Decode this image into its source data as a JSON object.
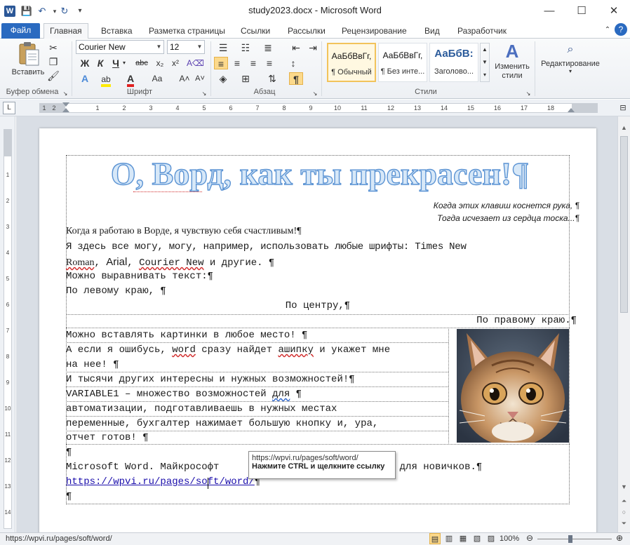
{
  "window": {
    "title": "study2023.docx - Microsoft Word",
    "app_icon_letter": "W",
    "controls": {
      "minimize": "—",
      "maximize": "☐",
      "close": "✕"
    }
  },
  "quick_access": {
    "save_icon": "💾",
    "undo_icon": "↶",
    "redo_icon": "↻",
    "customize_icon": "▾"
  },
  "tabs": [
    {
      "label": "Файл"
    },
    {
      "label": "Главная"
    },
    {
      "label": "Вставка"
    },
    {
      "label": "Разметка страницы"
    },
    {
      "label": "Ссылки"
    },
    {
      "label": "Рассылки"
    },
    {
      "label": "Рецензирование"
    },
    {
      "label": "Вид"
    },
    {
      "label": "Разработчик"
    }
  ],
  "ribbon": {
    "clipboard": {
      "label": "Буфер обмена",
      "paste_label": "Вставить"
    },
    "font": {
      "label": "Шрифт",
      "font_name": "Courier New",
      "font_size": "12",
      "bold": "Ж",
      "italic": "К",
      "underline": "Ч",
      "strike": "abc",
      "subscript": "x₂",
      "superscript": "x²",
      "grow": "A˄",
      "shrink": "A˅",
      "case": "Aa",
      "color_letter": "A"
    },
    "paragraph": {
      "label": "Абзац",
      "pilcrow": "¶"
    },
    "styles": {
      "label": "Стили",
      "items": [
        {
          "sample": "АаБбВвГг,",
          "name": "¶ Обычный"
        },
        {
          "sample": "АаБбВвГг,",
          "name": "¶ Без инте..."
        },
        {
          "sample": "АаБбВ:",
          "name": "Заголово..."
        }
      ],
      "change_styles": "Изменить стили"
    },
    "editing": {
      "label": "Редактирование"
    }
  },
  "document": {
    "wordart_title": "О, Ворд, как ты прекрасен!¶",
    "epigraph_1": "Когда этих клавиш коснется рука, ¶",
    "epigraph_2": "Тогда исчезает из сердца тоска...¶",
    "line_1": "Когда я работаю в Ворде, я чувствую себя счастливым!¶",
    "line_2a": "Я здесь все могу, могу, например, использовать любые  шрифты: Times New",
    "line_2b_times": "Roman",
    "line_2b_arial": "Arial",
    "line_2b_courier": "Courier New",
    "line_2b_rest": " и другие. ¶",
    "line_3": "Можно выравнивать текст:¶",
    "line_4": "По левому краю, ¶",
    "line_5": "По центру,¶",
    "line_6": "По правому краю.¶",
    "table_rows": [
      "Можно вставлять картинки в любое место! ¶",
      "А если я ошибусь, word сразу найдет ашипку и укажет мне ",
      "на нее! ¶",
      "И тысячи других интересны и нужных возможностей!¶",
      "VARIABLE1 – множество возможностей для  ¶",
      "автоматизации, подготавливаешь в нужных местах ",
      "переменные, бухгалтер нажимает большую кнопку и, ура, ",
      "отчет готов! ¶"
    ],
    "empty_para": "¶",
    "line_ms_start": "Microsoft Word. Майкрософт ",
    "line_ms_end": ". Курс для новичков.¶",
    "hyperlink": "https://wpvi.ru/pages/soft/word/",
    "hyperlink_pilcrow": "¶",
    "last_para": "¶",
    "image_alt": "cat photo"
  },
  "tooltip": {
    "url": "https://wpvi.ru/pages/soft/word/",
    "hint": "Нажмите CTRL и щелкните ссылку"
  },
  "status": {
    "url": "https://wpvi.ru/pages/soft/word/",
    "zoom": "100%"
  },
  "ruler_numbers": [
    "1",
    "2",
    "1",
    "2",
    "3",
    "4",
    "5",
    "6",
    "7",
    "8",
    "9",
    "10",
    "11",
    "12",
    "13",
    "14",
    "15",
    "16",
    "17",
    "18"
  ],
  "vruler_numbers": [
    "1",
    "2",
    "3",
    "4",
    "5",
    "6",
    "7",
    "8",
    "9",
    "10",
    "11",
    "12",
    "13",
    "14"
  ]
}
